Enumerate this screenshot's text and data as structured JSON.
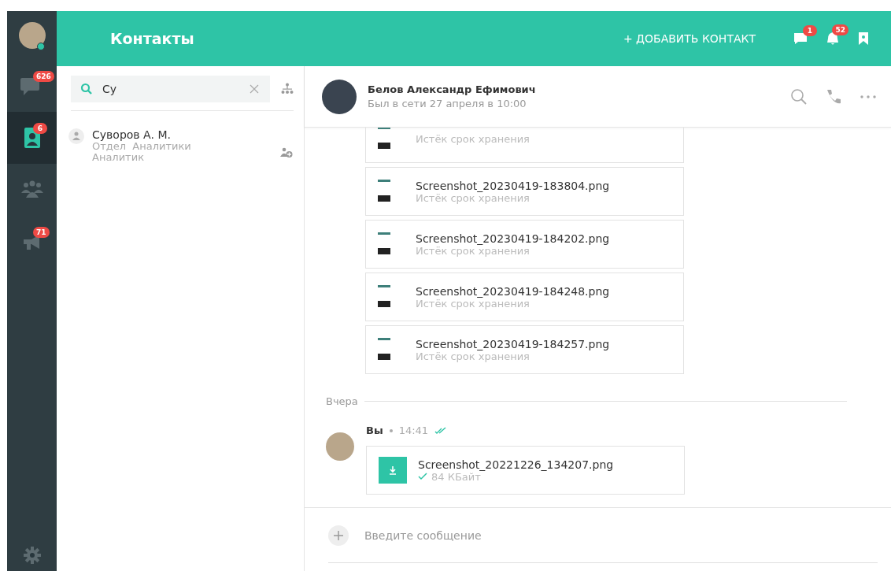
{
  "sidebar": {
    "online": true,
    "items": [
      {
        "kind": "chats",
        "badge": "626",
        "selected": false
      },
      {
        "kind": "contacts",
        "badge": "6",
        "selected": true
      },
      {
        "kind": "groups",
        "selected": false
      },
      {
        "kind": "broadcasts",
        "badge": "71",
        "selected": false
      }
    ]
  },
  "header": {
    "title": "Контакты",
    "add_button": "+ ДОБАВИТЬ КОНТАКТ",
    "mentions_badge": "1",
    "notifications_badge": "52"
  },
  "search": {
    "value": "Су"
  },
  "contacts": [
    {
      "name": "Суворов А. М.",
      "department": "Отдел  Аналитики",
      "position": "Аналитик"
    }
  ],
  "chat": {
    "name": "Белов Александр Ефимович",
    "status": "Был в сети 27 апреля в 10:00",
    "files": [
      {
        "note": "Истёк срок хранения"
      },
      {
        "name": "Screenshot_20230419-183804.png",
        "note": "Истёк срок хранения"
      },
      {
        "name": "Screenshot_20230419-184202.png",
        "note": "Истёк срок хранения"
      },
      {
        "name": "Screenshot_20230419-184248.png",
        "note": "Истёк срок хранения"
      },
      {
        "name": "Screenshot_20230419-184257.png",
        "note": "Истёк срок хранения"
      }
    ],
    "date": "Вчера",
    "message": {
      "author": "Вы",
      "time": "14:41",
      "read": true,
      "file": {
        "name": "Screenshot_20221226_134207.png",
        "size": "84 КБайт",
        "delivered": true
      }
    },
    "input": {
      "placeholder": "Введите сообщение"
    }
  }
}
